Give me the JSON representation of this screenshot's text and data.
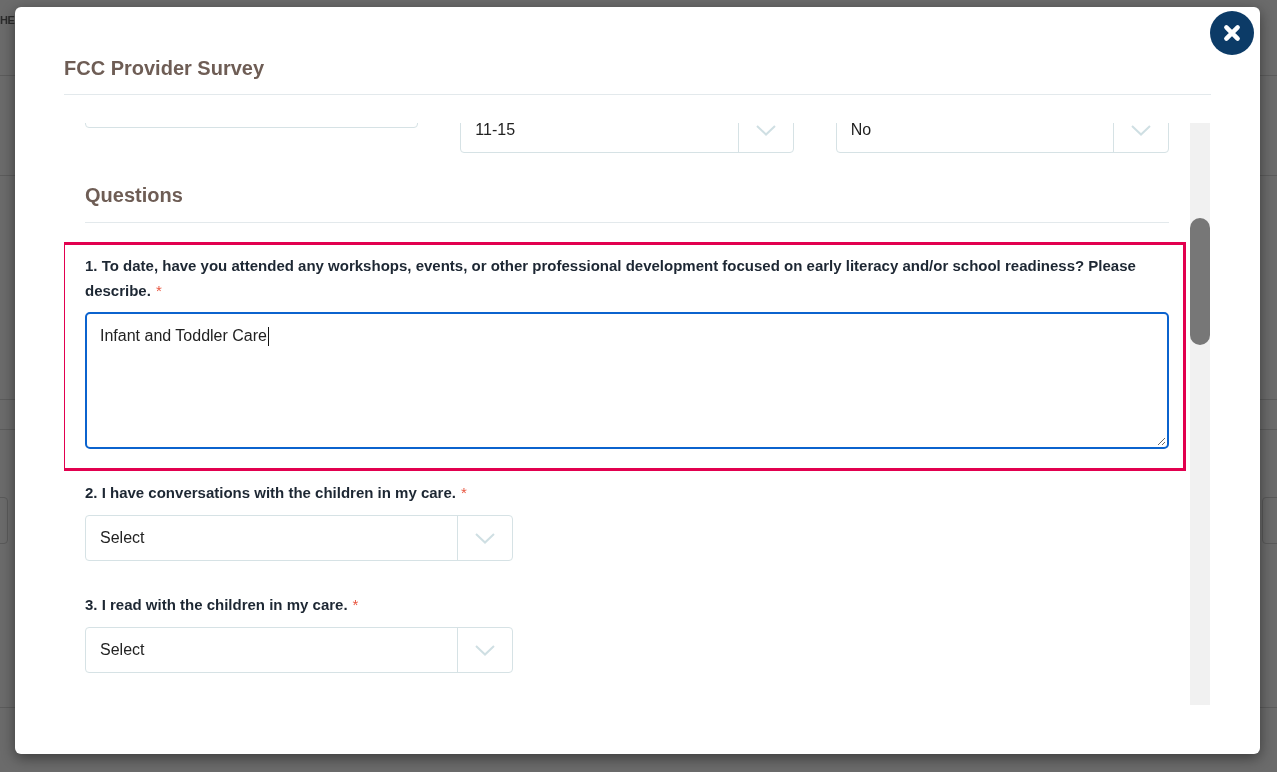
{
  "background_page": {
    "heading": "HE"
  },
  "dialog": {
    "title": "FCC Provider Survey"
  },
  "top_fields": [
    {
      "kind": "input"
    },
    {
      "kind": "select",
      "value": "11-15"
    },
    {
      "kind": "select",
      "value": "No"
    }
  ],
  "section": {
    "title": "Questions"
  },
  "questions": [
    {
      "label": "1. To date, have you attended any workshops, events, or other professional development focused on early literacy and/or school readiness? Please describe.",
      "required_mark": "*",
      "kind": "textarea",
      "value": "Infant and Toddler Care",
      "focused": true,
      "highlighted": true
    },
    {
      "label": "2. I have conversations with the children in my care.",
      "required_mark": "*",
      "kind": "select",
      "value": "Select",
      "focused": false,
      "highlighted": false
    },
    {
      "label": "3. I read with the children in my care.",
      "required_mark": "*",
      "kind": "select",
      "value": "Select",
      "focused": false,
      "highlighted": false
    }
  ]
}
